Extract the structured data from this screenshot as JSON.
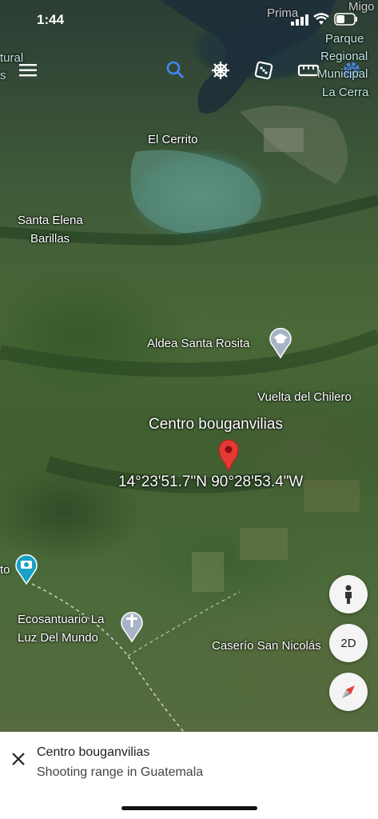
{
  "status": {
    "time": "1:44"
  },
  "map": {
    "labels": {
      "cultural": "tural",
      "cultural2": "s",
      "primavera": "Prima",
      "parque": "Parque",
      "regional": "Regional",
      "municipal": "Municipal",
      "la_cerra": "La Cerra",
      "el_cerrito": "El Cerrito",
      "santa_elena": "Santa Elena",
      "barillas": "Barillas",
      "aldea": "Aldea Santa Rosita",
      "vuelta": "Vuelta del Chilero",
      "centro": "Centro bouganvilias",
      "coords": "14°23'51.7\"N 90°28'53.4\"W",
      "to": "to",
      "eco1": "Ecosantuario La",
      "eco2": "Luz Del Mundo",
      "caserio": "Caserío San Nicolás",
      "migo": "Migo"
    }
  },
  "toolbar": {
    "search_icon": "search-icon",
    "voyager_icon": "ship-wheel-icon",
    "dice_icon": "dice-icon",
    "ruler_icon": "ruler-icon",
    "settings_icon": "gear-icon"
  },
  "controls": {
    "mode_2d": "2D"
  },
  "sheet": {
    "title": "Centro bouganvilias",
    "subtitle": "Shooting range in Guatemala"
  },
  "colors": {
    "pin": "#e53935",
    "search": "#4285f4"
  }
}
